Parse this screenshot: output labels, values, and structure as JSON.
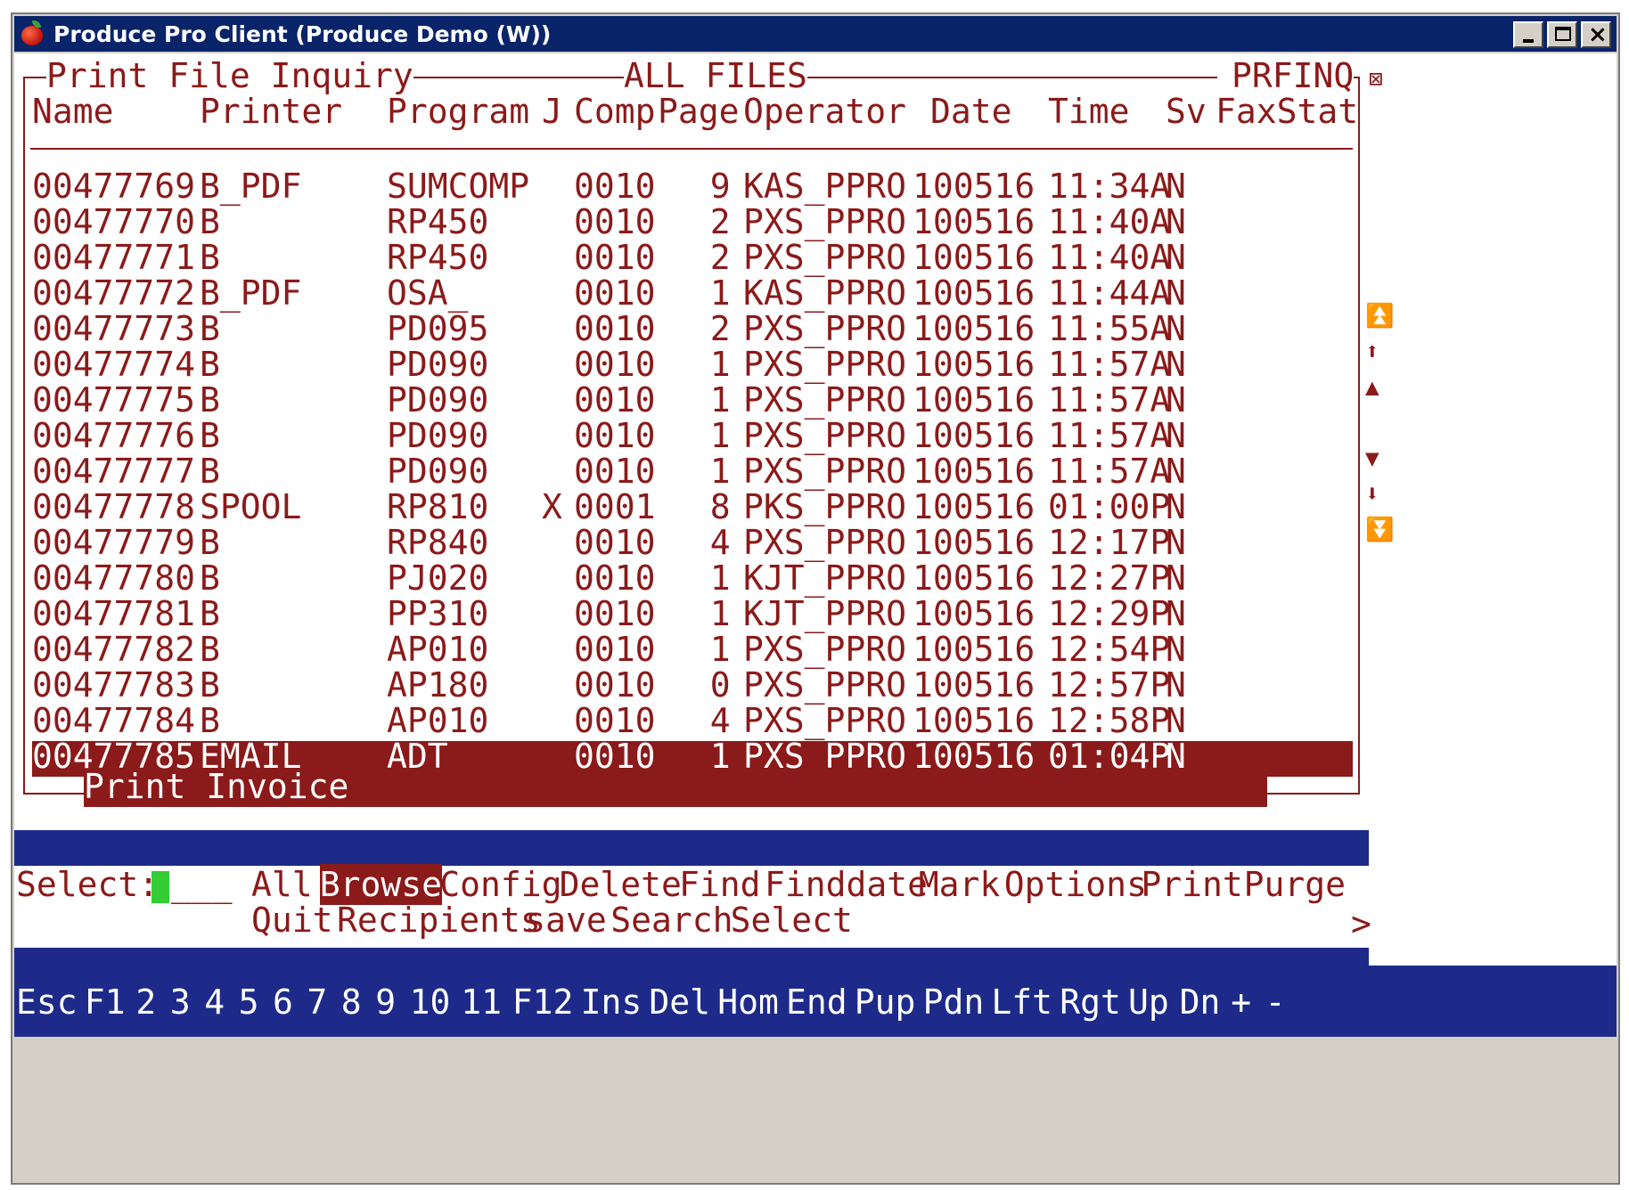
{
  "window": {
    "title": "Produce Pro Client (Produce Demo (W))"
  },
  "screen": {
    "title": "Print File Inquiry",
    "filter": "ALL FILES",
    "program_id": "PRFINQ",
    "close_icon": "⊠",
    "columns": [
      "Name",
      "Printer",
      "Program",
      "J",
      "Comp",
      "Page",
      "Operator",
      "Date",
      "Time",
      "Sv",
      "FaxStat"
    ],
    "rows": [
      {
        "name": "00477769",
        "printer": "B_PDF",
        "program": "SUMCOMP",
        "j": "",
        "comp": "0010",
        "page": "9",
        "operator": "KAS_PPRO",
        "date": "100516",
        "time": "11:34A",
        "sv": "N"
      },
      {
        "name": "00477770",
        "printer": "B",
        "program": "RP450",
        "j": "",
        "comp": "0010",
        "page": "2",
        "operator": "PXS_PPRO",
        "date": "100516",
        "time": "11:40A",
        "sv": "N"
      },
      {
        "name": "00477771",
        "printer": "B",
        "program": "RP450",
        "j": "",
        "comp": "0010",
        "page": "2",
        "operator": "PXS_PPRO",
        "date": "100516",
        "time": "11:40A",
        "sv": "N"
      },
      {
        "name": "00477772",
        "printer": "B_PDF",
        "program": "OSA_",
        "j": "",
        "comp": "0010",
        "page": "1",
        "operator": "KAS_PPRO",
        "date": "100516",
        "time": "11:44A",
        "sv": "N"
      },
      {
        "name": "00477773",
        "printer": "B",
        "program": "PD095",
        "j": "",
        "comp": "0010",
        "page": "2",
        "operator": "PXS_PPRO",
        "date": "100516",
        "time": "11:55A",
        "sv": "N"
      },
      {
        "name": "00477774",
        "printer": "B",
        "program": "PD090",
        "j": "",
        "comp": "0010",
        "page": "1",
        "operator": "PXS_PPRO",
        "date": "100516",
        "time": "11:57A",
        "sv": "N"
      },
      {
        "name": "00477775",
        "printer": "B",
        "program": "PD090",
        "j": "",
        "comp": "0010",
        "page": "1",
        "operator": "PXS_PPRO",
        "date": "100516",
        "time": "11:57A",
        "sv": "N"
      },
      {
        "name": "00477776",
        "printer": "B",
        "program": "PD090",
        "j": "",
        "comp": "0010",
        "page": "1",
        "operator": "PXS_PPRO",
        "date": "100516",
        "time": "11:57A",
        "sv": "N"
      },
      {
        "name": "00477777",
        "printer": "B",
        "program": "PD090",
        "j": "",
        "comp": "0010",
        "page": "1",
        "operator": "PXS_PPRO",
        "date": "100516",
        "time": "11:57A",
        "sv": "N"
      },
      {
        "name": "00477778",
        "printer": "SPOOL",
        "program": "RP810",
        "j": "X",
        "comp": "0001",
        "page": "8",
        "operator": "PKS_PPRO",
        "date": "100516",
        "time": "01:00P",
        "sv": "N"
      },
      {
        "name": "00477779",
        "printer": "B",
        "program": "RP840",
        "j": "",
        "comp": "0010",
        "page": "4",
        "operator": "PXS_PPRO",
        "date": "100516",
        "time": "12:17P",
        "sv": "N"
      },
      {
        "name": "00477780",
        "printer": "B",
        "program": "PJ020",
        "j": "",
        "comp": "0010",
        "page": "1",
        "operator": "KJT_PPRO",
        "date": "100516",
        "time": "12:27P",
        "sv": "N"
      },
      {
        "name": "00477781",
        "printer": "B",
        "program": "PP310",
        "j": "",
        "comp": "0010",
        "page": "1",
        "operator": "KJT_PPRO",
        "date": "100516",
        "time": "12:29P",
        "sv": "N"
      },
      {
        "name": "00477782",
        "printer": "B",
        "program": "AP010",
        "j": "",
        "comp": "0010",
        "page": "1",
        "operator": "PXS_PPRO",
        "date": "100516",
        "time": "12:54P",
        "sv": "N"
      },
      {
        "name": "00477783",
        "printer": "B",
        "program": "AP180",
        "j": "",
        "comp": "0010",
        "page": "0",
        "operator": "PXS_PPRO",
        "date": "100516",
        "time": "12:57P",
        "sv": "N"
      },
      {
        "name": "00477784",
        "printer": "B",
        "program": "AP010",
        "j": "",
        "comp": "0010",
        "page": "4",
        "operator": "PXS_PPRO",
        "date": "100516",
        "time": "12:58P",
        "sv": "N"
      },
      {
        "name": "00477785",
        "printer": "EMAIL",
        "program": "ADT_",
        "j": "",
        "comp": "0010",
        "page": "1",
        "operator": "PXS_PPRO",
        "date": "100516",
        "time": "01:04P",
        "sv": "N"
      }
    ],
    "selected_description": "Print Invoice",
    "scroll_icons": [
      "⏫",
      "⬆",
      "▲",
      "▼",
      "⬇",
      "⏬"
    ]
  },
  "select_bar": {
    "label": "Select:",
    "input_tail": "___",
    "line1": [
      "All",
      "Browse",
      "Config",
      "Delete",
      "Find",
      "Finddate",
      "Mark",
      "Options",
      "Print",
      "Purge"
    ],
    "line2": [
      "Quit",
      "Recipients",
      "save",
      "Search",
      "Select"
    ],
    "more": ">"
  },
  "fkeys": [
    "Esc",
    "F1",
    "2",
    "3",
    "4",
    "5",
    "6",
    "7",
    "8",
    "9",
    "10",
    "11",
    "F12",
    "Ins",
    "Del",
    "Hom",
    "End",
    "Pup",
    "Pdn",
    "Lft",
    "Rgt",
    "Up",
    "Dn",
    "+",
    "-"
  ]
}
